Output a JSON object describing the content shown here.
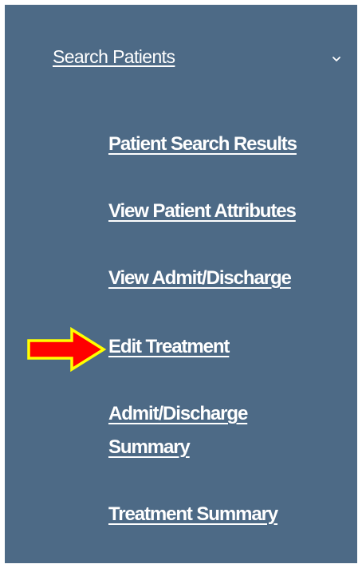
{
  "section": {
    "label": "Search Patients",
    "chevron_icon": "chevron-down-icon"
  },
  "nav": {
    "items": [
      {
        "label": "Patient Search Results"
      },
      {
        "label": "View Patient Attributes"
      },
      {
        "label": "View Admit/Discharge"
      },
      {
        "label": "Edit Treatment"
      },
      {
        "label": "Admit/Discharge Summary"
      },
      {
        "label": "Treatment Summary"
      }
    ]
  },
  "highlight": {
    "icon": "arrow-right-icon",
    "fill_color": "#ff0000",
    "outline_color": "#ffff00"
  },
  "colors": {
    "panel_background": "#4d6a86",
    "link_text": "#ffffff"
  }
}
